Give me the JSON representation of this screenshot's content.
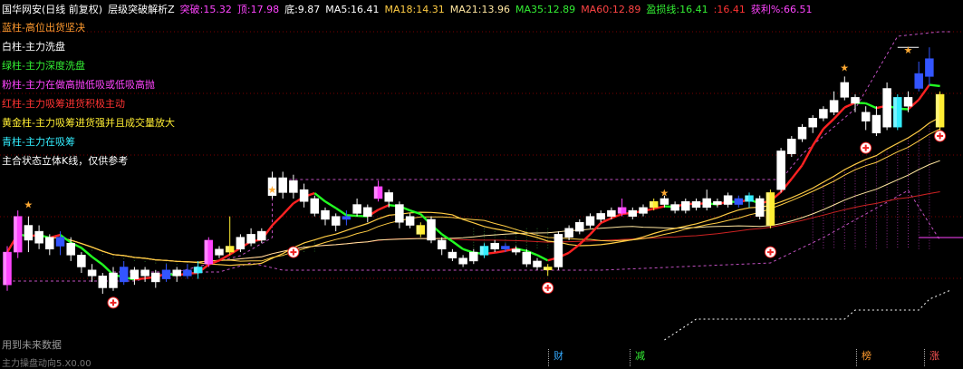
{
  "header": {
    "name": "国华网安(日线 前复权)",
    "indicator": "层级突破解析Z",
    "tupo_label": "突破:",
    "tupo": "15.32",
    "ding_label": "顶:",
    "ding": "17.98",
    "di_label": "底:",
    "di": "9.87",
    "ma5_label": "MA5:",
    "ma5": "16.41",
    "ma18_label": "MA18:",
    "ma18": "14.31",
    "ma21_label": "MA21:",
    "ma21": "13.96",
    "ma35_label": "MA35:",
    "ma35": "12.89",
    "ma60_label": "MA60:",
    "ma60": "12.89",
    "yingsun_label": "盈损线:",
    "yingsun": "16.41",
    "extra": ":16.41",
    "huoli_label": "获利%:",
    "huoli": "66.51"
  },
  "legend": [
    {
      "text": "蓝柱-高位出货坚决",
      "color": "#ff9a2e"
    },
    {
      "text": "白柱-主力洗盘",
      "color": "#ffffff"
    },
    {
      "text": "绿柱-主力深度洗盘",
      "color": "#33ee33"
    },
    {
      "text": "粉柱-主力在做高抛低吸或低吸高抛",
      "color": "#ff44ff"
    },
    {
      "text": "红柱-主力吸筹进货积极主动",
      "color": "#ff3333"
    },
    {
      "text": "黄金柱-主力吸筹进货强并且成交量放大",
      "color": "#ffee33"
    },
    {
      "text": "青柱-主力在吸筹",
      "color": "#33eeff"
    },
    {
      "text": "主合状态立体K线，仅供参考",
      "color": "#ffffff"
    }
  ],
  "footer": {
    "note": "用到未来数据",
    "bottom": "主力操盘动向5.X0.00"
  },
  "bottom_tags": [
    {
      "text": "财",
      "color": "#33aaff"
    },
    {
      "text": "减",
      "color": "#33ee33"
    },
    {
      "text": "榜",
      "color": "#ff9a2e"
    },
    {
      "text": "涨",
      "color": "#ff5555"
    }
  ],
  "colors": {
    "up": "#ff3333",
    "down": "#33ee33",
    "white": "#ffffff",
    "pink": "#ff44ff",
    "gold": "#ffee33",
    "cyan": "#33eeff",
    "blue": "#3355ff",
    "ma_red": "#ff2222",
    "ma_green": "#22ff22",
    "ma_gold": "#ffcc44",
    "ma_pale": "#ffe6a0",
    "ma_dark": "#cc2222",
    "dash": "#c050c0"
  },
  "chart_data": {
    "type": "candlestick",
    "ylim": [
      8.3,
      18.9
    ],
    "bars": [
      {
        "o": 10.0,
        "c": 11.1,
        "h": 11.3,
        "l": 9.8,
        "color": "pink"
      },
      {
        "o": 11.1,
        "c": 12.3,
        "h": 12.5,
        "l": 10.9,
        "color": "pink"
      },
      {
        "o": 12.0,
        "c": 11.5,
        "h": 12.3,
        "l": 11.1,
        "color": "green"
      },
      {
        "o": 11.4,
        "c": 11.8,
        "h": 12.0,
        "l": 11.2,
        "color": "red"
      },
      {
        "o": 11.6,
        "c": 11.2,
        "h": 11.7,
        "l": 11.0,
        "color": "white"
      },
      {
        "o": 11.3,
        "c": 11.6,
        "h": 11.8,
        "l": 11.0,
        "color": "blue"
      },
      {
        "o": 11.4,
        "c": 11.0,
        "h": 11.6,
        "l": 10.8,
        "color": "white"
      },
      {
        "o": 11.0,
        "c": 10.6,
        "h": 11.1,
        "l": 10.4,
        "color": "green"
      },
      {
        "o": 10.5,
        "c": 10.3,
        "h": 10.7,
        "l": 10.1,
        "color": "white"
      },
      {
        "o": 10.3,
        "c": 9.9,
        "h": 10.4,
        "l": 9.7,
        "color": "white"
      },
      {
        "o": 10.4,
        "c": 9.9,
        "h": 10.6,
        "l": 9.8,
        "color": "red"
      },
      {
        "o": 10.1,
        "c": 10.6,
        "h": 10.8,
        "l": 10.0,
        "color": "blue"
      },
      {
        "o": 10.5,
        "c": 10.2,
        "h": 10.6,
        "l": 10.0,
        "color": "white"
      },
      {
        "o": 10.3,
        "c": 10.5,
        "h": 10.6,
        "l": 10.1,
        "color": "white"
      },
      {
        "o": 10.4,
        "c": 10.1,
        "h": 10.5,
        "l": 9.9,
        "color": "white"
      },
      {
        "o": 10.2,
        "c": 10.5,
        "h": 10.7,
        "l": 10.1,
        "color": "blue"
      },
      {
        "o": 10.5,
        "c": 10.3,
        "h": 10.6,
        "l": 10.1,
        "color": "white"
      },
      {
        "o": 10.3,
        "c": 10.5,
        "h": 10.7,
        "l": 10.2,
        "color": "blue"
      },
      {
        "o": 10.4,
        "c": 10.6,
        "h": 10.8,
        "l": 10.2,
        "color": "cyan"
      },
      {
        "o": 10.7,
        "c": 11.5,
        "h": 11.6,
        "l": 10.6,
        "color": "pink"
      },
      {
        "o": 11.0,
        "c": 11.2,
        "h": 11.3,
        "l": 10.9,
        "color": "white"
      },
      {
        "o": 11.1,
        "c": 11.3,
        "h": 12.3,
        "l": 11.0,
        "color": "gold"
      },
      {
        "o": 11.2,
        "c": 11.6,
        "h": 11.7,
        "l": 11.1,
        "color": "white"
      },
      {
        "o": 11.4,
        "c": 11.7,
        "h": 11.9,
        "l": 11.3,
        "color": "red"
      },
      {
        "o": 11.5,
        "c": 11.8,
        "h": 11.9,
        "l": 11.4,
        "color": "white"
      },
      {
        "o": 13.0,
        "c": 13.6,
        "h": 13.8,
        "l": 12.9,
        "color": "red"
      },
      {
        "o": 13.6,
        "c": 13.1,
        "h": 13.8,
        "l": 12.9,
        "color": "white"
      },
      {
        "o": 13.1,
        "c": 13.5,
        "h": 13.7,
        "l": 12.9,
        "color": "green"
      },
      {
        "o": 13.2,
        "c": 12.8,
        "h": 13.4,
        "l": 12.6,
        "color": "white"
      },
      {
        "o": 12.9,
        "c": 12.4,
        "h": 13.0,
        "l": 12.3,
        "color": "white"
      },
      {
        "o": 12.5,
        "c": 12.2,
        "h": 12.6,
        "l": 12.0,
        "color": "white"
      },
      {
        "o": 12.3,
        "c": 12.0,
        "h": 12.4,
        "l": 11.8,
        "color": "white"
      },
      {
        "o": 12.2,
        "c": 12.3,
        "h": 12.5,
        "l": 12.0,
        "color": "blue"
      },
      {
        "o": 12.4,
        "c": 12.7,
        "h": 12.9,
        "l": 12.3,
        "color": "red"
      },
      {
        "o": 12.6,
        "c": 12.3,
        "h": 12.7,
        "l": 12.1,
        "color": "white"
      },
      {
        "o": 12.9,
        "c": 13.3,
        "h": 13.5,
        "l": 12.8,
        "color": "pink"
      },
      {
        "o": 13.1,
        "c": 12.8,
        "h": 13.2,
        "l": 12.6,
        "color": "white"
      },
      {
        "o": 12.7,
        "c": 12.1,
        "h": 12.8,
        "l": 11.9,
        "color": "white"
      },
      {
        "o": 12.3,
        "c": 12.0,
        "h": 12.4,
        "l": 11.9,
        "color": "white"
      },
      {
        "o": 12.0,
        "c": 11.7,
        "h": 12.1,
        "l": 11.6,
        "color": "gold"
      },
      {
        "o": 12.2,
        "c": 11.5,
        "h": 12.3,
        "l": 11.4,
        "color": "green"
      },
      {
        "o": 11.5,
        "c": 11.2,
        "h": 11.6,
        "l": 11.0,
        "color": "white"
      },
      {
        "o": 11.1,
        "c": 10.9,
        "h": 11.2,
        "l": 10.8,
        "color": "white"
      },
      {
        "o": 10.9,
        "c": 10.7,
        "h": 11.0,
        "l": 10.6,
        "color": "green"
      },
      {
        "o": 10.8,
        "c": 11.1,
        "h": 11.2,
        "l": 10.7,
        "color": "white"
      },
      {
        "o": 11.0,
        "c": 11.3,
        "h": 11.4,
        "l": 10.9,
        "color": "cyan"
      },
      {
        "o": 11.2,
        "c": 11.4,
        "h": 11.5,
        "l": 11.1,
        "color": "white"
      },
      {
        "o": 11.3,
        "c": 11.2,
        "h": 11.4,
        "l": 11.1,
        "color": "blue"
      },
      {
        "o": 11.2,
        "c": 11.1,
        "h": 11.3,
        "l": 11.0,
        "color": "white"
      },
      {
        "o": 11.1,
        "c": 10.7,
        "h": 11.2,
        "l": 10.6,
        "color": "green"
      },
      {
        "o": 10.8,
        "c": 10.6,
        "h": 10.9,
        "l": 10.5,
        "color": "white"
      },
      {
        "o": 10.6,
        "c": 10.5,
        "h": 10.7,
        "l": 10.3,
        "color": "gold"
      },
      {
        "o": 10.6,
        "c": 11.7,
        "h": 11.8,
        "l": 10.5,
        "color": "red"
      },
      {
        "o": 11.6,
        "c": 11.9,
        "h": 12.0,
        "l": 11.5,
        "color": "white"
      },
      {
        "o": 11.8,
        "c": 12.1,
        "h": 12.2,
        "l": 11.7,
        "color": "white"
      },
      {
        "o": 12.0,
        "c": 12.3,
        "h": 12.4,
        "l": 11.9,
        "color": "red"
      },
      {
        "o": 12.2,
        "c": 12.4,
        "h": 12.5,
        "l": 12.1,
        "color": "white"
      },
      {
        "o": 12.3,
        "c": 12.5,
        "h": 12.6,
        "l": 12.2,
        "color": "red"
      },
      {
        "o": 12.4,
        "c": 12.6,
        "h": 12.9,
        "l": 12.3,
        "color": "pink"
      },
      {
        "o": 12.5,
        "c": 12.3,
        "h": 12.6,
        "l": 12.2,
        "color": "green"
      },
      {
        "o": 12.4,
        "c": 12.6,
        "h": 12.7,
        "l": 12.3,
        "color": "white"
      },
      {
        "o": 12.6,
        "c": 12.8,
        "h": 12.9,
        "l": 12.5,
        "color": "gold"
      },
      {
        "o": 12.7,
        "c": 12.9,
        "h": 13.0,
        "l": 12.6,
        "color": "red"
      },
      {
        "o": 12.7,
        "c": 12.5,
        "h": 12.8,
        "l": 12.4,
        "color": "white"
      },
      {
        "o": 12.5,
        "c": 12.8,
        "h": 12.9,
        "l": 12.4,
        "color": "white"
      },
      {
        "o": 12.8,
        "c": 12.6,
        "h": 12.9,
        "l": 12.5,
        "color": "white"
      },
      {
        "o": 12.6,
        "c": 12.9,
        "h": 13.2,
        "l": 12.5,
        "color": "green"
      },
      {
        "o": 12.8,
        "c": 12.7,
        "h": 12.9,
        "l": 12.6,
        "color": "white"
      },
      {
        "o": 12.7,
        "c": 13.0,
        "h": 13.1,
        "l": 12.6,
        "color": "red"
      },
      {
        "o": 12.9,
        "c": 12.7,
        "h": 13.0,
        "l": 12.6,
        "color": "blue"
      },
      {
        "o": 12.8,
        "c": 13.0,
        "h": 13.1,
        "l": 12.6,
        "color": "cyan"
      },
      {
        "o": 12.9,
        "c": 12.3,
        "h": 13.0,
        "l": 12.2,
        "color": "green"
      },
      {
        "o": 12.0,
        "c": 13.1,
        "h": 13.2,
        "l": 11.9,
        "color": "gold"
      },
      {
        "o": 13.2,
        "c": 14.5,
        "h": 14.6,
        "l": 13.1,
        "color": "red"
      },
      {
        "o": 14.4,
        "c": 14.9,
        "h": 15.0,
        "l": 14.3,
        "color": "red"
      },
      {
        "o": 14.9,
        "c": 15.3,
        "h": 15.4,
        "l": 14.8,
        "color": "red"
      },
      {
        "o": 15.3,
        "c": 15.6,
        "h": 15.7,
        "l": 15.1,
        "color": "red"
      },
      {
        "o": 15.6,
        "c": 15.9,
        "h": 16.0,
        "l": 15.5,
        "color": "red"
      },
      {
        "o": 15.8,
        "c": 16.2,
        "h": 16.5,
        "l": 15.7,
        "color": "red"
      },
      {
        "o": 16.3,
        "c": 16.8,
        "h": 17.0,
        "l": 16.2,
        "color": "green"
      },
      {
        "o": 16.3,
        "c": 16.1,
        "h": 16.4,
        "l": 15.8,
        "color": "white"
      },
      {
        "o": 15.8,
        "c": 15.5,
        "h": 16.0,
        "l": 15.2,
        "color": "white"
      },
      {
        "o": 15.7,
        "c": 15.1,
        "h": 16.0,
        "l": 15.0,
        "color": "red"
      },
      {
        "o": 15.3,
        "c": 16.6,
        "h": 16.8,
        "l": 15.2,
        "color": "red"
      },
      {
        "o": 15.3,
        "c": 16.3,
        "h": 16.4,
        "l": 15.2,
        "color": "cyan"
      },
      {
        "o": 16.3,
        "c": 16.0,
        "h": 16.5,
        "l": 15.8,
        "color": "white"
      },
      {
        "o": 16.6,
        "c": 17.1,
        "h": 17.5,
        "l": 16.5,
        "color": "blue"
      },
      {
        "o": 17.0,
        "c": 17.6,
        "h": 17.98,
        "l": 16.7,
        "color": "blue"
      },
      {
        "o": 15.3,
        "c": 16.4,
        "h": 16.5,
        "l": 15.1,
        "color": "gold"
      }
    ]
  }
}
